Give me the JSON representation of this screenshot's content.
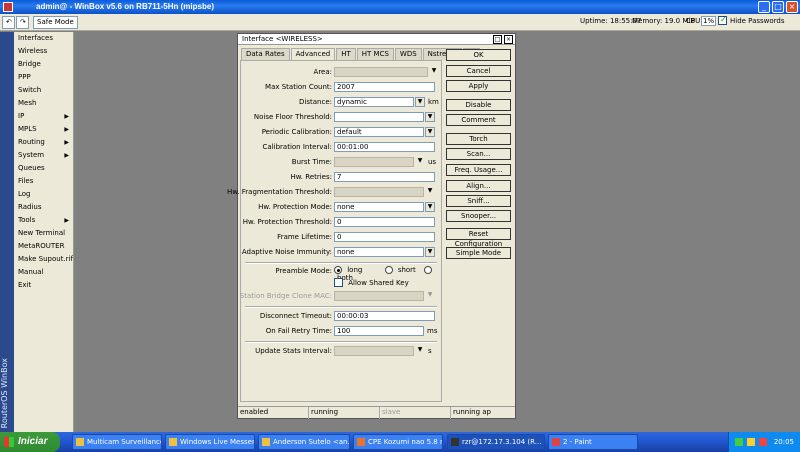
{
  "window": {
    "title": "WinBox v5.6 on RB711-5Hn (mipsbe)",
    "title_prefix": "admin@"
  },
  "toolbar": {
    "safe_mode": "Safe Mode",
    "uptime": "Uptime: 18:55:07",
    "memory": "Memory: 19.0 MiB",
    "cpu_label": "CPU:",
    "cpu_value": "1%",
    "hide_passwords": "Hide Passwords"
  },
  "sidebar": {
    "brand": "RouterOS WinBox",
    "items": [
      {
        "label": "Interfaces"
      },
      {
        "label": "Wireless"
      },
      {
        "label": "Bridge"
      },
      {
        "label": "PPP"
      },
      {
        "label": "Switch"
      },
      {
        "label": "Mesh"
      },
      {
        "label": "IP"
      },
      {
        "label": "MPLS"
      },
      {
        "label": "Routing"
      },
      {
        "label": "System"
      },
      {
        "label": "Queues"
      },
      {
        "label": "Files"
      },
      {
        "label": "Log"
      },
      {
        "label": "Radius"
      },
      {
        "label": "Tools"
      },
      {
        "label": "New Terminal"
      },
      {
        "label": "MetaROUTER"
      },
      {
        "label": "Make Supout.rif"
      },
      {
        "label": "Manual"
      },
      {
        "label": "Exit"
      }
    ]
  },
  "dialog": {
    "title": "Interface <WIRELESS>",
    "tabs": [
      "Data Rates",
      "Advanced",
      "HT",
      "HT MCS",
      "WDS",
      "Nstreme",
      "..."
    ],
    "fields": {
      "area": {
        "label": "Area:",
        "value": ""
      },
      "max_station_count": {
        "label": "Max Station Count:",
        "value": "2007"
      },
      "distance": {
        "label": "Distance:",
        "value": "dynamic",
        "unit": "km"
      },
      "noise_floor_threshold": {
        "label": "Noise Floor Threshold:",
        "value": ""
      },
      "periodic_calibration": {
        "label": "Periodic Calibration:",
        "value": "default"
      },
      "calibration_interval": {
        "label": "Calibration Interval:",
        "value": "00:01:00"
      },
      "burst_time": {
        "label": "Burst Time:",
        "value": "",
        "unit": "us"
      },
      "hw_retries": {
        "label": "Hw. Retries:",
        "value": "7"
      },
      "hw_fragmentation_threshold": {
        "label": "Hw. Fragmentation Threshold:",
        "value": ""
      },
      "hw_protection_mode": {
        "label": "Hw. Protection Mode:",
        "value": "none"
      },
      "hw_protection_threshold": {
        "label": "Hw. Protection Threshold:",
        "value": "0"
      },
      "frame_lifetime": {
        "label": "Frame Lifetime:",
        "value": "0"
      },
      "adaptive_noise_immunity": {
        "label": "Adaptive Noise Immunity:",
        "value": "none"
      },
      "preamble_mode": {
        "label": "Preamble Mode:",
        "options": [
          "long",
          "short",
          "both"
        ],
        "selected": "long"
      },
      "allow_shared_key": {
        "label": "Allow Shared Key"
      },
      "station_bridge_clone_mac": {
        "label": "Station Bridge Clone MAC:",
        "value": ""
      },
      "disconnect_timeout": {
        "label": "Disconnect Timeout:",
        "value": "00:00:03"
      },
      "on_fail_retry_time": {
        "label": "On Fail Retry Time:",
        "value": "100",
        "unit": "ms"
      },
      "update_stats_interval": {
        "label": "Update Stats Interval:",
        "value": "",
        "unit": "s"
      }
    },
    "buttons": [
      "OK",
      "Cancel",
      "Apply",
      "Disable",
      "Comment",
      "Torch",
      "Scan...",
      "Freq. Usage...",
      "Align...",
      "Sniff...",
      "Snooper...",
      "Reset Configuration",
      "Simple Mode"
    ],
    "status": [
      "enabled",
      "running",
      "slave",
      "running ap"
    ]
  },
  "taskbar": {
    "start": "Iniciar",
    "tasks": [
      {
        "label": "Multicam Surveillance ..."
      },
      {
        "label": "Windows Live Messen..."
      },
      {
        "label": "Anderson Sutelo <an..."
      },
      {
        "label": "CPE Kozumi nao 5.8 n..."
      },
      {
        "label": "rzr@172.17.3.104 (R..."
      },
      {
        "label": "2 - Paint"
      }
    ],
    "clock": "20:05"
  }
}
